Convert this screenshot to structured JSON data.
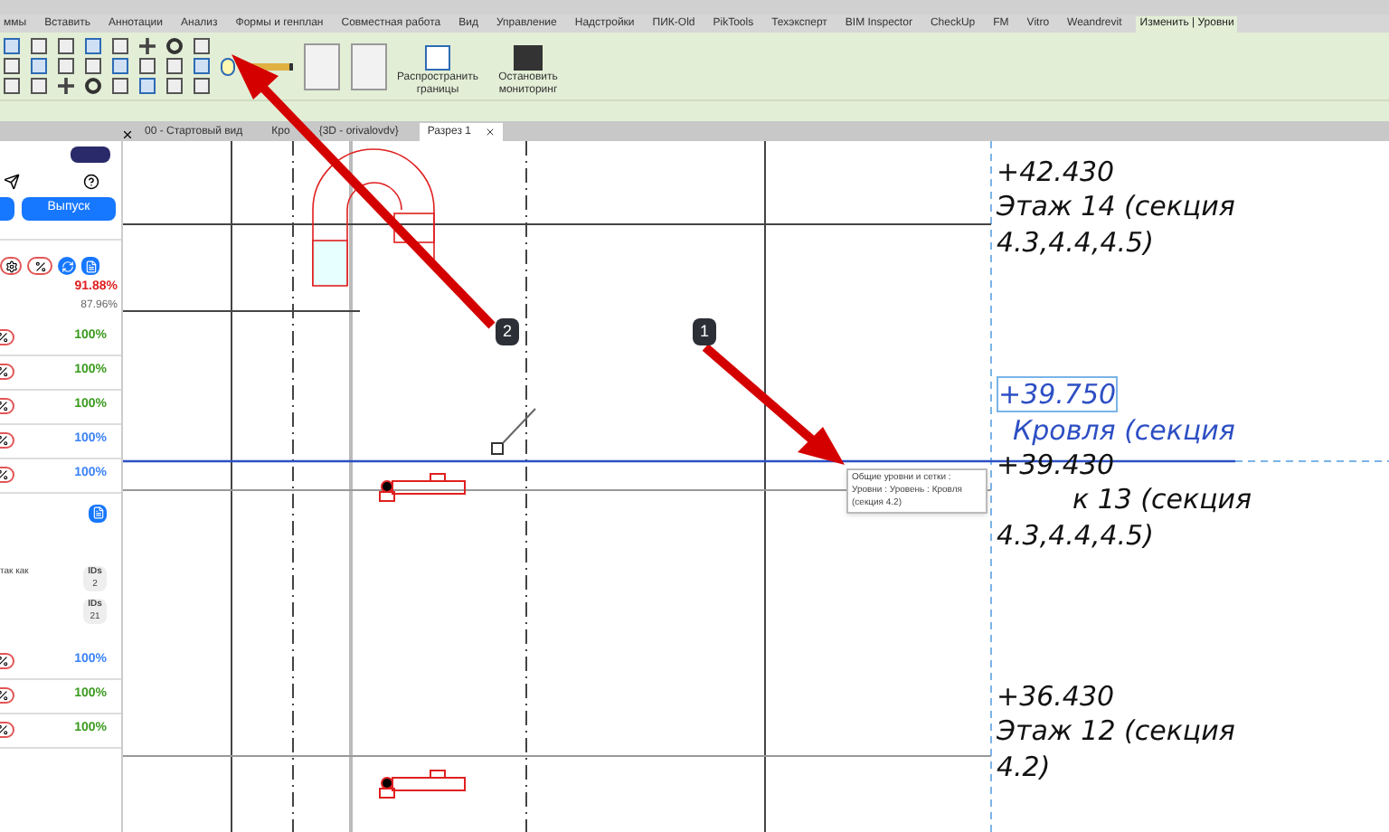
{
  "menu_tabs": [
    {
      "label": "ммы",
      "selected": false
    },
    {
      "label": "Вставить",
      "selected": false
    },
    {
      "label": "Аннотации",
      "selected": false
    },
    {
      "label": "Анализ",
      "selected": false
    },
    {
      "label": "Формы и генплан",
      "selected": false
    },
    {
      "label": "Совместная работа",
      "selected": false
    },
    {
      "label": "Вид",
      "selected": false
    },
    {
      "label": "Управление",
      "selected": false
    },
    {
      "label": "Надстройки",
      "selected": false
    },
    {
      "label": "ПИК-Old",
      "selected": false
    },
    {
      "label": "PikTools",
      "selected": false
    },
    {
      "label": "Техэксперт",
      "selected": false
    },
    {
      "label": "BIM Inspector",
      "selected": false
    },
    {
      "label": "CheckUp",
      "selected": false
    },
    {
      "label": "FM",
      "selected": false
    },
    {
      "label": "Vitro",
      "selected": false
    },
    {
      "label": "Weandrevit",
      "selected": false
    },
    {
      "label": "Изменить | Уровни",
      "selected": true
    }
  ],
  "ribbon": {
    "buttons": [
      {
        "label": "Распространить границы"
      },
      {
        "label": "Остановить мониторинг"
      }
    ]
  },
  "view_tabs": [
    {
      "label": "00 - Стартовый вид",
      "selected": false
    },
    {
      "label": "Кро",
      "selected": false
    },
    {
      "label": "{3D - orivalovdv}",
      "selected": false
    },
    {
      "label": "Разрез 1",
      "selected": true
    }
  ],
  "side_panel": {
    "issue_button": "Выпуск",
    "total": "91.88%",
    "subtotal": "87.96%",
    "rows": [
      {
        "value": "100%",
        "color": "#3a9a1e"
      },
      {
        "value": "100%",
        "color": "#3a9a1e"
      },
      {
        "value": "100%",
        "color": "#3a9a1e"
      },
      {
        "value": "100%",
        "color": "#3b82f6"
      },
      {
        "value": "100%",
        "color": "#3b82f6"
      }
    ],
    "note": "так как",
    "id_badges": [
      {
        "label": "IDs",
        "count": "2"
      },
      {
        "label": "IDs",
        "count": "21"
      }
    ],
    "rows_2": [
      {
        "value": "100%",
        "color": "#3b82f6"
      },
      {
        "value": "100%",
        "color": "#3a9a1e"
      },
      {
        "value": "100%",
        "color": "#3a9a1e"
      }
    ]
  },
  "canvas": {
    "levels": [
      {
        "elevation": "+42.430",
        "name_lines": [
          "Этаж 14 (секция",
          "4.3,4.4,4.5)"
        ],
        "selected": false
      },
      {
        "elevation": "+39.750",
        "name_lines": [
          "Кровля (секция"
        ],
        "selected": true
      },
      {
        "elevation": "+39.430",
        "name_lines": [
          "к 13 (секция",
          "4.3,4.4,4.5)"
        ],
        "selected": false
      },
      {
        "elevation": "+36.430",
        "name_lines": [
          "Этаж 12 (секция",
          "4.2)"
        ],
        "selected": false
      }
    ],
    "tooltip": [
      "Общие уровни и сетки : Уровни : Уровень : Кровля",
      "(секция 4.2)"
    ],
    "callouts": [
      "2",
      "1"
    ]
  }
}
